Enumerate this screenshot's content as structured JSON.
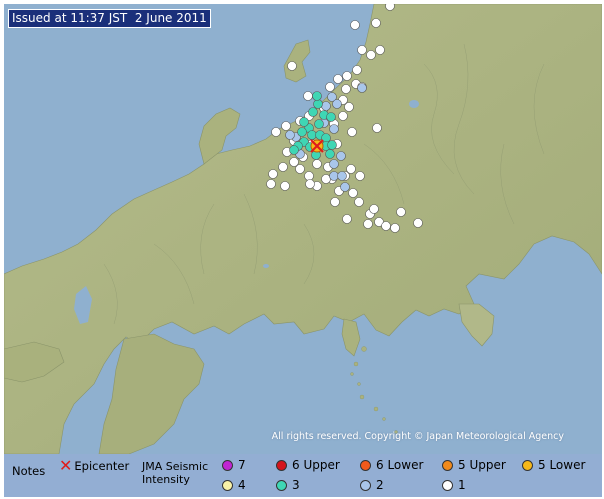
{
  "issued": "Issued at 11:37 JST  2 June 2011",
  "copyright": "All rights reserved. Copyright © Japan Meteorological Agency",
  "legend": {
    "notes": "Notes",
    "epicenter": "Epicenter",
    "jma_label": "JMA Seismic Intensity",
    "items": [
      {
        "label": "7",
        "color": "#c026d3"
      },
      {
        "label": "6 Upper",
        "color": "#d4141c"
      },
      {
        "label": "6 Lower",
        "color": "#f05a1c"
      },
      {
        "label": "5 Upper",
        "color": "#f08a1c"
      },
      {
        "label": "5 Lower",
        "color": "#f5b81a"
      },
      {
        "label": "4",
        "color": "#f8f2a8"
      },
      {
        "label": "3",
        "color": "#3fd6b4"
      },
      {
        "label": "2",
        "color": "#a9c6ea"
      },
      {
        "label": "1",
        "color": "#ffffff"
      }
    ]
  },
  "colors": {
    "sea": "#8fb0cf",
    "land": "#aab27e",
    "epicenter": "#e01b1b"
  },
  "map_data": {
    "epicenter_intensity": "3",
    "stations_intensity_3": 20,
    "stations_intensity_2": 14,
    "stations_intensity_1": 60
  }
}
